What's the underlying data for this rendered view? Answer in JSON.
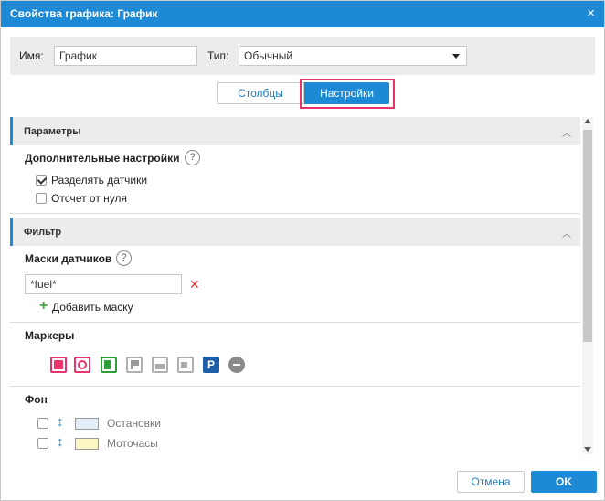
{
  "dialog": {
    "title": "Свойства графика: График",
    "close_glyph": "×"
  },
  "name_row": {
    "name_label": "Имя:",
    "name_value": "График",
    "type_label": "Тип:",
    "type_value": "Обычный"
  },
  "tabs": [
    {
      "label": "Столбцы",
      "active": false
    },
    {
      "label": "Настройки",
      "active": true
    }
  ],
  "params": {
    "header": "Параметры",
    "extra_title": "Дополнительные настройки",
    "help_glyph": "?",
    "checkboxes": [
      {
        "label": "Разделять датчики",
        "checked": true
      },
      {
        "label": "Отсчет от нуля",
        "checked": false
      }
    ]
  },
  "filter": {
    "header": "Фильтр",
    "masks_title": "Маски датчиков",
    "help_glyph": "?",
    "mask_value": "*fuel*",
    "delete_glyph": "✕",
    "add_mask_label": "Добавить маску",
    "add_glyph": "+"
  },
  "markers": {
    "title": "Маркеры",
    "items": [
      {
        "name": "fuel-filling-marker-icon",
        "color": "#e8336b"
      },
      {
        "name": "speed-marker-icon",
        "color": "#e8336b"
      },
      {
        "name": "fuel-station-marker-icon",
        "color": "#2e9e3a"
      },
      {
        "name": "flag-marker-icon",
        "color": "#9a9a9a"
      },
      {
        "name": "image-marker-icon",
        "color": "#9a9a9a"
      },
      {
        "name": "video-marker-icon",
        "color": "#9a9a9a"
      },
      {
        "name": "parking-marker-icon",
        "color": "#1e5fa8",
        "glyph": "P"
      },
      {
        "name": "minus-marker-icon",
        "color": "#8a8a8a"
      }
    ]
  },
  "background": {
    "title": "Фон",
    "items": [
      {
        "label": "Остановки",
        "swatch_color": "#e3eef8",
        "checked": false
      },
      {
        "label": "Моточасы",
        "swatch_color": "#fbf7c4",
        "checked": false
      }
    ]
  },
  "footer": {
    "cancel_label": "Отмена",
    "ok_label": "OK"
  },
  "colors": {
    "accent": "#1e8ad6",
    "highlight": "#e8336b"
  }
}
